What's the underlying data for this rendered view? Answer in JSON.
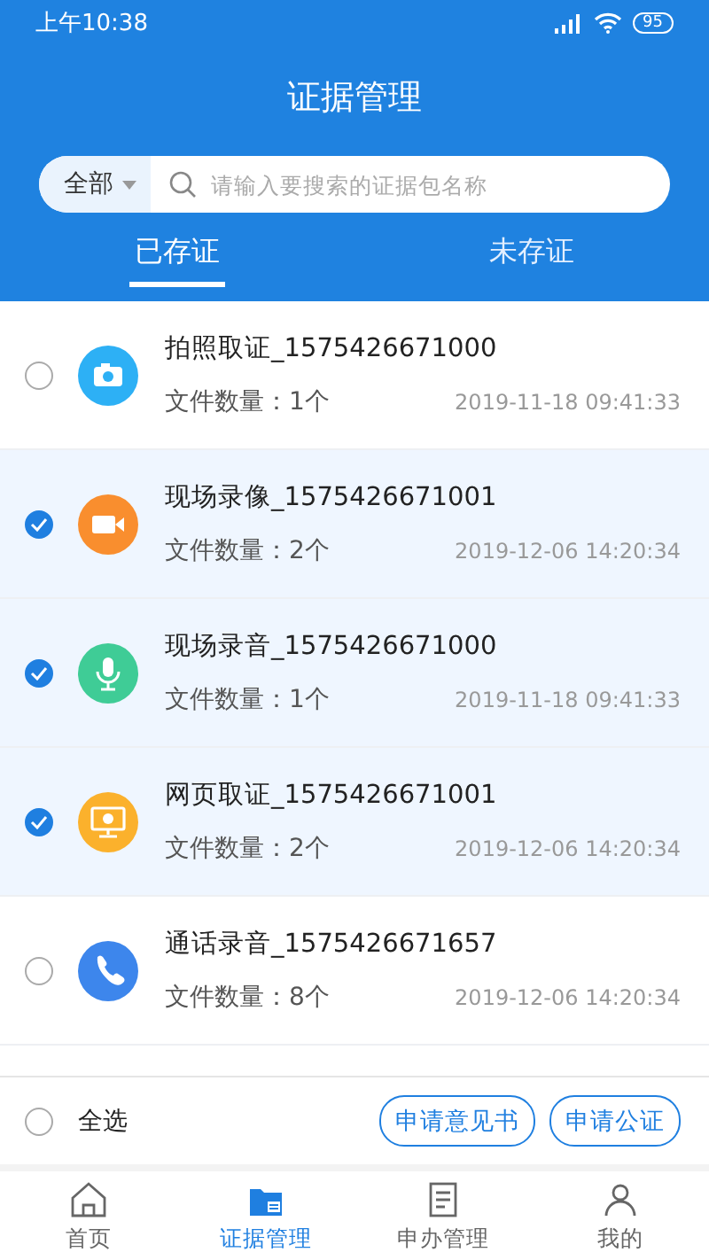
{
  "status_bar": {
    "time": "上午10:38",
    "battery": "95"
  },
  "title": "证据管理",
  "search": {
    "filter": "全部",
    "placeholder": "请输入要搜索的证据包名称"
  },
  "tabs": [
    {
      "label": "已存证",
      "selected": true
    },
    {
      "label": "未存证",
      "selected": false
    }
  ],
  "items": [
    {
      "name": "拍照取证_1575426671000",
      "count": "文件数量：1个",
      "time": "2019-11-18 09:41:33",
      "kind": "camera",
      "color": "#2db0f5",
      "checked": false
    },
    {
      "name": "现场录像_1575426671001",
      "count": "文件数量：2个",
      "time": "2019-12-06 14:20:34",
      "kind": "video",
      "color": "#f98e2e",
      "checked": true
    },
    {
      "name": "现场录音_1575426671000",
      "count": "文件数量：1个",
      "time": "2019-11-18 09:41:33",
      "kind": "mic",
      "color": "#3fcc96",
      "checked": true
    },
    {
      "name": "网页取证_1575426671001",
      "count": "文件数量：2个",
      "time": "2019-12-06 14:20:34",
      "kind": "web",
      "color": "#fbb12c",
      "checked": true
    },
    {
      "name": "通话录音_1575426671657",
      "count": "文件数量：8个",
      "time": "2019-12-06 14:20:34",
      "kind": "phone",
      "color": "#3d86ec",
      "checked": false
    }
  ],
  "actions": {
    "select_all": {
      "label": "全选",
      "checked": false
    },
    "buttons": [
      "申请意见书",
      "申请公证"
    ]
  },
  "nav": [
    {
      "label": "首页",
      "kind": "home",
      "selected": false
    },
    {
      "label": "证据管理",
      "kind": "files",
      "selected": true
    },
    {
      "label": "申办管理",
      "kind": "doc",
      "selected": false
    },
    {
      "label": "我的",
      "kind": "user",
      "selected": false
    }
  ]
}
